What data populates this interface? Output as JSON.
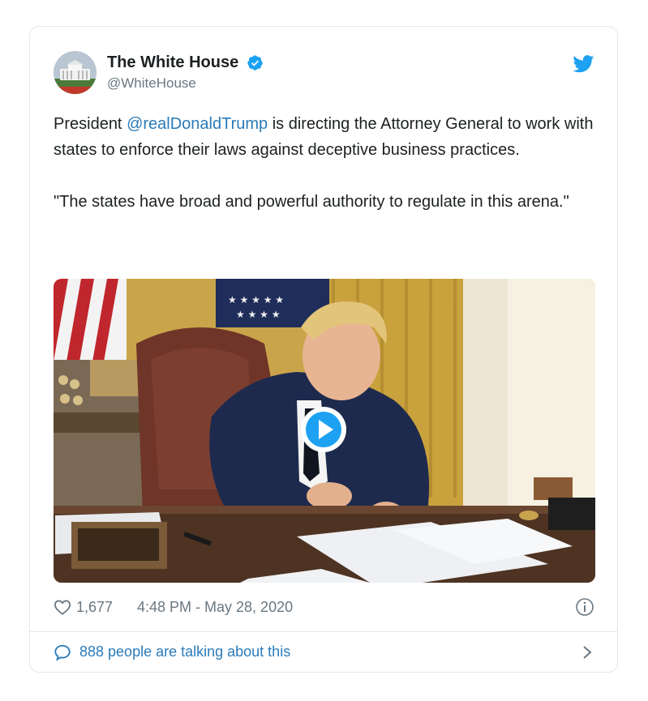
{
  "account": {
    "display_name": "The White House",
    "handle": "@WhiteHouse",
    "verified": true
  },
  "tweet": {
    "text_before": "President ",
    "mention": "@realDonaldTrump",
    "text_after": " is directing the Attorney General to work with states to enforce their laws against deceptive business practices.\n\n\"The states have broad and powerful authority to regulate in this arena.\""
  },
  "media": {
    "type": "video",
    "play_icon": "play-icon"
  },
  "meta": {
    "like_count": "1,677",
    "timestamp": "4:48 PM - May 28, 2020"
  },
  "footer": {
    "talk_label": "888 people are talking about this"
  },
  "colors": {
    "link": "#2b7bb9",
    "twitter_blue": "#1da1f2",
    "secondary_text": "#697882",
    "border": "#e1e8ed"
  },
  "icons": [
    "twitter-bird-icon",
    "verified-badge-icon",
    "heart-icon",
    "info-icon",
    "speech-bubble-icon",
    "chevron-right-icon"
  ]
}
